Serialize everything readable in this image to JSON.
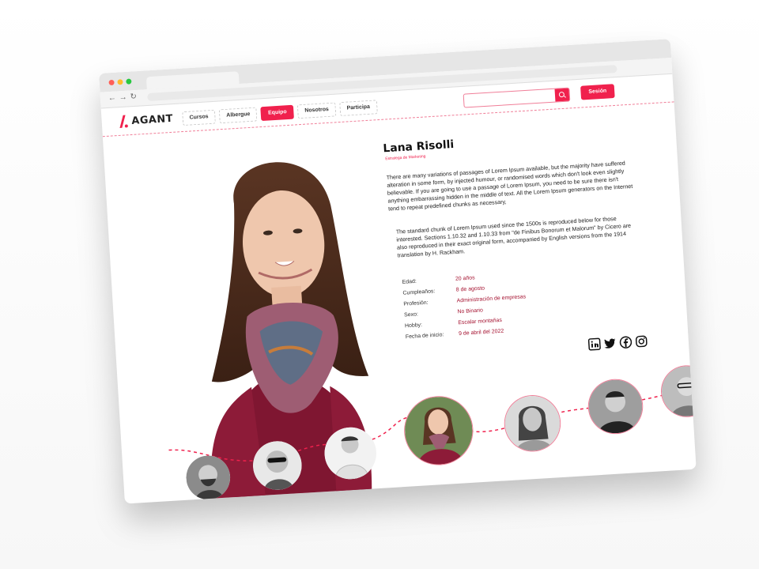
{
  "header": {
    "logo_text": "AGANT",
    "nav": [
      {
        "label": "Cursos",
        "active": false
      },
      {
        "label": "Albergue",
        "active": false
      },
      {
        "label": "Equipo",
        "active": true
      },
      {
        "label": "Nosotros",
        "active": false
      },
      {
        "label": "Participa",
        "active": false
      }
    ],
    "search_placeholder": "",
    "search_icon": "search-icon",
    "login_label": "Sesión"
  },
  "browser": {
    "nav_icons": [
      "back-arrow-icon",
      "forward-arrow-icon",
      "reload-icon"
    ]
  },
  "profile": {
    "name": "Lana Risolli",
    "role": "Estratega de Marketing",
    "paragraph_1": "There are many variations of passages of Lorem Ipsum available, but the majority have suffered alteration in some form, by injected humour, or randomised words which don't look even slightly believable. If you are going to use a passage of Lorem Ipsum, you need to be sure there isn't anything embarrassing hidden in the middle of text. All the Lorem Ipsum generators on the Internet tend to repeat predefined chunks as necessary,",
    "paragraph_2": "The standard chunk of Lorem Ipsum used since the 1500s is reproduced below for those interested. Sections 1.10.32 and 1.10.33 from \"de Finibus Bonorum et Malorum\" by Cicero are also reproduced in their exact original form, accompanied by English versions from the 1914 translation by H. Rackham.",
    "details": [
      {
        "label": "Edad:",
        "value": "20 años"
      },
      {
        "label": "Cumpleaños:",
        "value": "8 de agosto"
      },
      {
        "label": "Profesión:",
        "value": "Administración de empresas"
      },
      {
        "label": "Sexo:",
        "value": "No Binario"
      },
      {
        "label": "Hobby:",
        "value": "Escalar montañas"
      },
      {
        "label": "Fecha de inicio:",
        "value": "9 de abril del 2022"
      }
    ]
  },
  "socials": [
    "linkedin-icon",
    "twitter-icon",
    "facebook-icon",
    "instagram-icon"
  ],
  "team_carousel": {
    "members": [
      {
        "id": "member-1",
        "color": "grayscale"
      },
      {
        "id": "member-2",
        "color": "grayscale"
      },
      {
        "id": "member-3",
        "color": "grayscale"
      },
      {
        "id": "member-4",
        "color": "color",
        "selected": true
      },
      {
        "id": "member-5",
        "color": "grayscale"
      },
      {
        "id": "member-6",
        "color": "grayscale"
      },
      {
        "id": "member-7",
        "color": "grayscale"
      }
    ]
  },
  "colors": {
    "accent": "#f0214d",
    "value_text": "#a51331",
    "dashed_line": "#f07e98"
  }
}
